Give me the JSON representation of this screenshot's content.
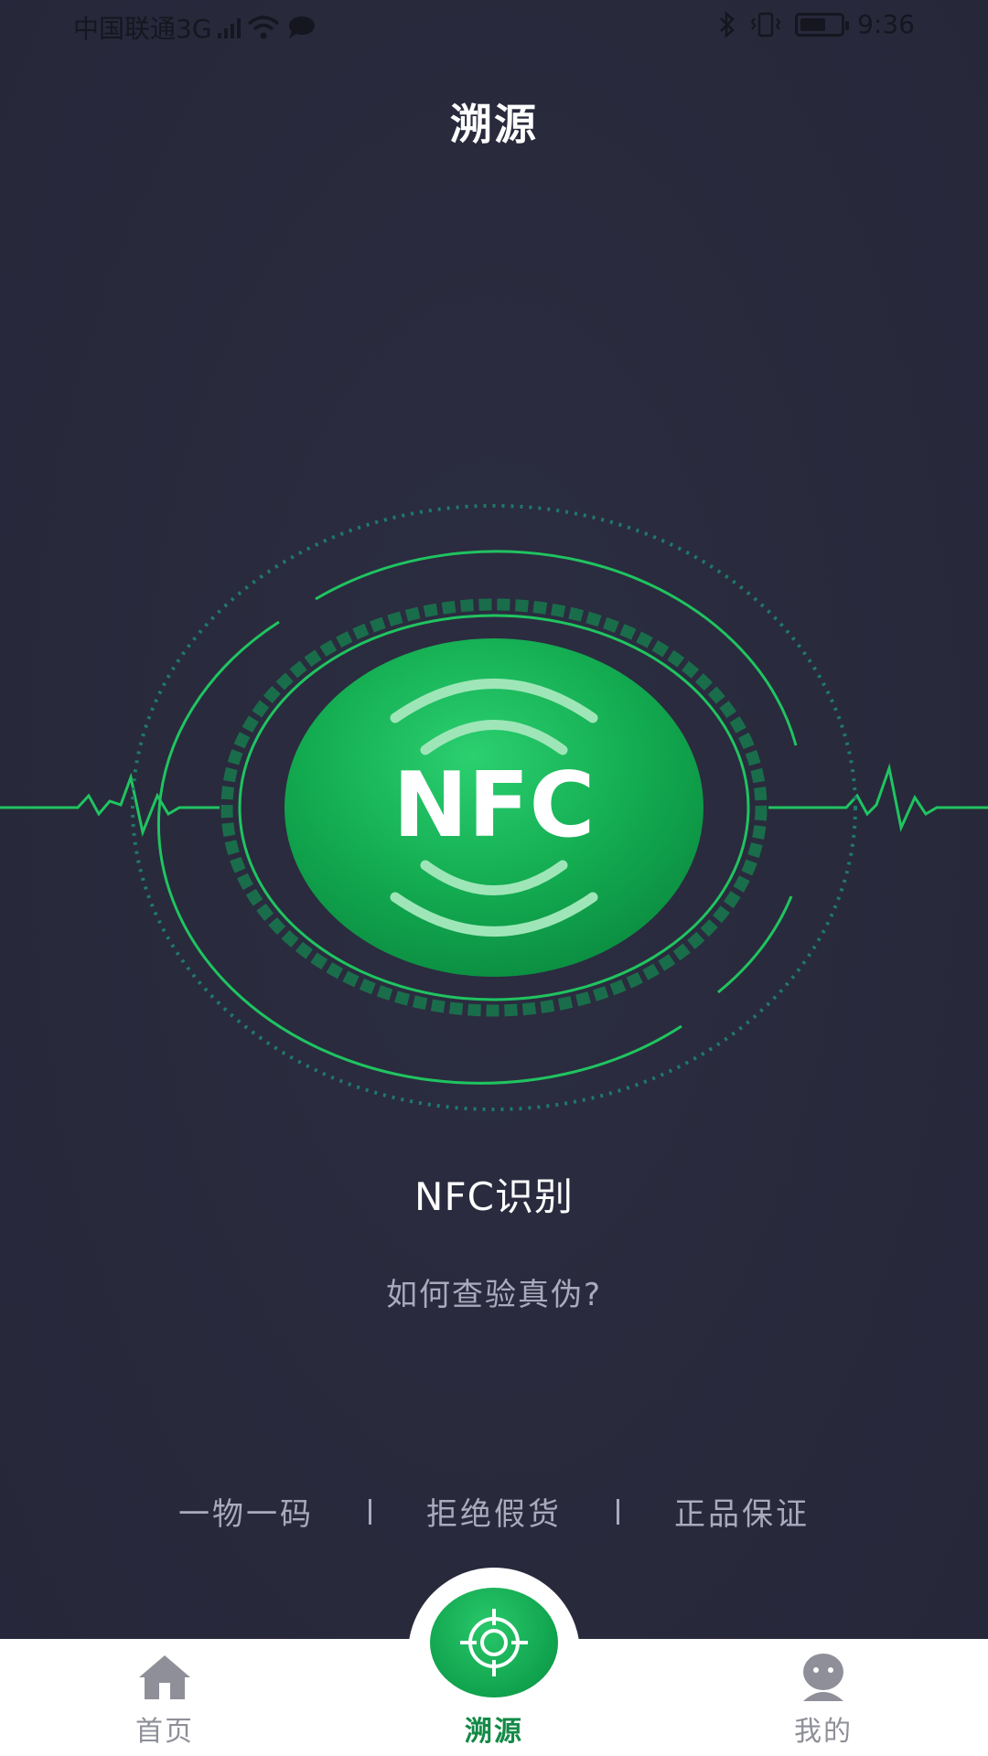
{
  "status_bar": {
    "carrier": "中国联通3G",
    "network_badge": "3G",
    "time": "9:36",
    "icons": [
      "signal-icon",
      "wifi-icon",
      "chat-bubble-icon",
      "bluetooth-icon",
      "vibrate-icon",
      "battery-icon"
    ]
  },
  "header": {
    "title": "溯源"
  },
  "nfc_button": {
    "label": "NFC"
  },
  "main": {
    "title": "NFC识别",
    "question": "如何查验真伪?",
    "features": [
      "一物一码",
      "拒绝假货",
      "正品保证"
    ]
  },
  "bottom_nav": {
    "items": [
      {
        "label": "首页",
        "icon": "home-icon",
        "active": false
      },
      {
        "label": "溯源",
        "icon": "crosshair-icon",
        "active": true
      },
      {
        "label": "我的",
        "icon": "user-icon",
        "active": false
      }
    ]
  },
  "colors": {
    "background": "#28293b",
    "accent_green": "#10a24d",
    "line_green": "#1fc460",
    "text_muted": "#a9abbd",
    "nav_active": "#138a46",
    "nav_inactive": "#8e8f98"
  }
}
